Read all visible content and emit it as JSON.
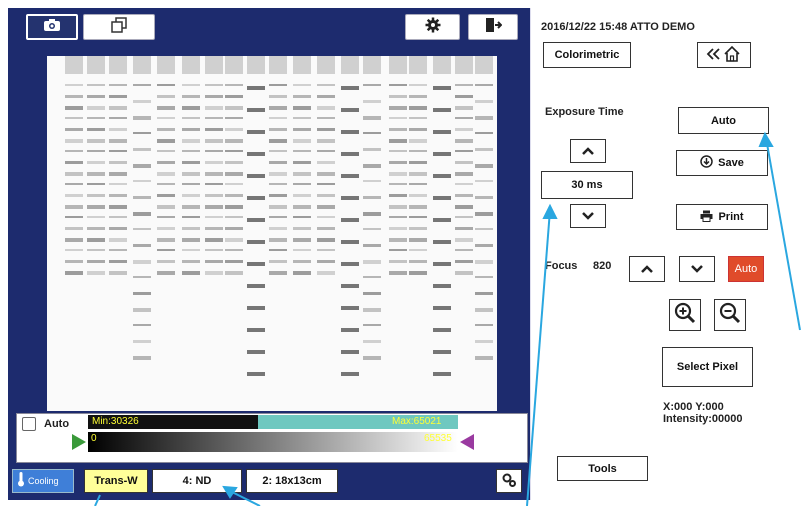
{
  "tabs": {
    "camera": "camera-icon",
    "windows": "windows-icon"
  },
  "toolbar": {
    "settings_icon": "gear-icon",
    "exit_icon": "exit-door-icon"
  },
  "histogram": {
    "auto_label": "Auto",
    "min_label": "Min:30326",
    "max_label": "Max:65021",
    "range_start": "0",
    "range_end": "65535",
    "colors": {
      "min_bar": "#111111",
      "max_bar": "#6fc8c0",
      "range_label": "#ffff33",
      "left_marker": "#3a9a3a",
      "right_marker": "#9a3aa0"
    }
  },
  "bottom_bar": {
    "cooling_label": "Cooling",
    "filter_label": "Trans-W",
    "nd_label": "4: ND",
    "size_label": "2: 18x13cm"
  },
  "right_panel": {
    "timestamp": "2016/12/22 15:48  ATTO DEMO",
    "colorimetric_label": "Colorimetric",
    "exposure_title": "Exposure Time",
    "exposure_value": "30 ms",
    "auto_label": "Auto",
    "save_label": "Save",
    "print_label": "Print",
    "focus_label": "Focus",
    "focus_value": "820",
    "focus_auto_label": "Auto",
    "select_pixel_label": "Select Pixel",
    "xy_readout": "X:000 Y:000",
    "intensity_readout": "Intensity:00000",
    "tools_label": "Tools",
    "accent_color": "#e04b2a"
  }
}
